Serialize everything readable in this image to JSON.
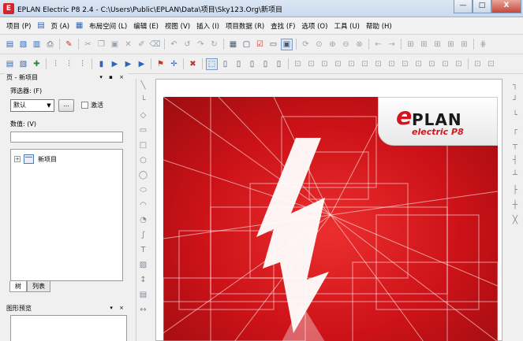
{
  "window": {
    "app_icon_letter": "E",
    "title": "EPLAN Electric P8 2.4 - C:\\Users\\Public\\EPLAN\\Data\\项目\\Sky123.Org\\新项目",
    "minimize": "—",
    "maximize": "□",
    "close": "X"
  },
  "menu": {
    "items": [
      "项目 (P)",
      "页 (A)",
      "布局空间 (L)",
      "编辑 (E)",
      "视图 (V)",
      "插入 (I)",
      "项目数据 (R)",
      "查找 (F)",
      "选项 (O)",
      "工具 (U)",
      "帮助 (H)"
    ]
  },
  "left_panel": {
    "title": "页 - 新项目",
    "controls": "▾ ▪ ×",
    "filter_label": "筛选器: (F)",
    "filter_value": "默认",
    "dots_button": "...",
    "activate_label": "激活",
    "value_label": "数值: (V)",
    "tree": {
      "expander": "+",
      "root_label": "新项目"
    },
    "tabs": [
      "树",
      "列表"
    ]
  },
  "preview_panel": {
    "title": "图形预览",
    "controls": "▾ ×"
  },
  "splash": {
    "logo_e": "e",
    "logo_plan": "PLAN",
    "logo_sub": "electric P8"
  },
  "colors": {
    "splash_red": "#cc1218",
    "brand_red": "#d4161c",
    "title_bar": "#c9d9ee"
  }
}
